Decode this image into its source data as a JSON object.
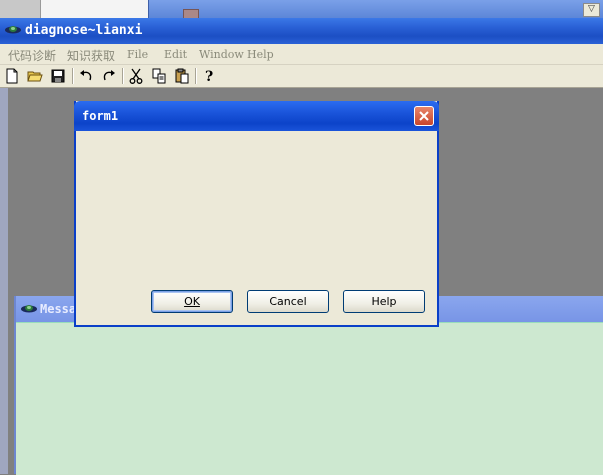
{
  "app": {
    "title": "diagnose~lianxi"
  },
  "menu": {
    "items": [
      {
        "label": "代码诊断"
      },
      {
        "label": "知识获取"
      },
      {
        "label": "File"
      },
      {
        "label": "Edit"
      },
      {
        "label": "Window"
      },
      {
        "label": "Help"
      }
    ]
  },
  "toolbar": {
    "buttons": [
      {
        "icon": "new-file-icon"
      },
      {
        "icon": "open-folder-icon"
      },
      {
        "icon": "save-icon"
      },
      {
        "icon": "undo-icon"
      },
      {
        "icon": "redo-icon"
      },
      {
        "icon": "cut-icon"
      },
      {
        "icon": "copy-icon"
      },
      {
        "icon": "paste-icon"
      },
      {
        "icon": "help-icon"
      }
    ]
  },
  "message_window": {
    "title": "Messa"
  },
  "dialog": {
    "title": "form1",
    "ok_label": "OK",
    "cancel_label": "Cancel",
    "help_label": "Help"
  },
  "colors": {
    "titlebar": "#2a61d6",
    "dialog_border": "#0a3fc8",
    "menubar": "#ece9d8",
    "mdi_background": "#808080",
    "message_body": "#cde8d0",
    "close_button": "#c9452a"
  }
}
